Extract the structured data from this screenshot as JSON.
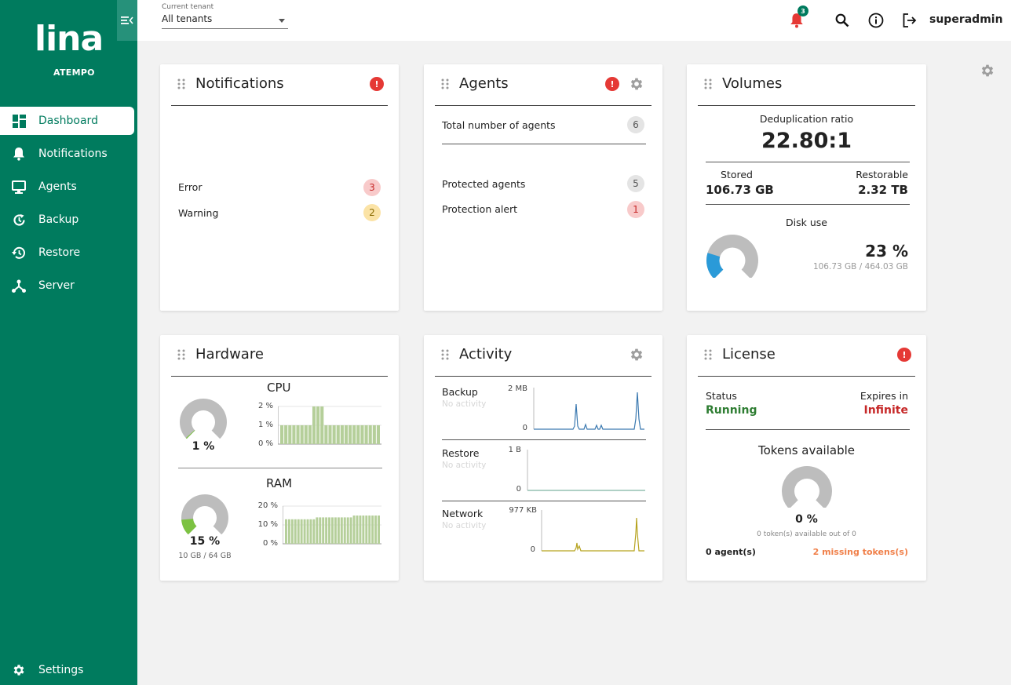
{
  "brand": {
    "logo": "lina",
    "logo_sub": "ATEMPO"
  },
  "sidebar": {
    "items": [
      {
        "label": "Dashboard",
        "icon": "dashboard-icon",
        "active": true
      },
      {
        "label": "Notifications",
        "icon": "bell-icon"
      },
      {
        "label": "Agents",
        "icon": "monitor-icon"
      },
      {
        "label": "Backup",
        "icon": "backup-icon"
      },
      {
        "label": "Restore",
        "icon": "restore-icon"
      },
      {
        "label": "Server",
        "icon": "server-icon"
      }
    ],
    "settings_label": "Settings"
  },
  "topbar": {
    "tenant_label": "Current tenant",
    "tenant_value": "All tenants",
    "notification_count": "3",
    "username": "superadmin"
  },
  "notifications": {
    "title": "Notifications",
    "alert": "!",
    "rows": [
      {
        "label": "Error",
        "count": "3"
      },
      {
        "label": "Warning",
        "count": "2"
      }
    ]
  },
  "agents": {
    "title": "Agents",
    "alert": "!",
    "total_label": "Total number of agents",
    "total": "6",
    "protected_label": "Protected agents",
    "protected": "5",
    "alert_label": "Protection alert",
    "alert_count": "1"
  },
  "volumes": {
    "title": "Volumes",
    "dedup_label": "Deduplication ratio",
    "dedup_value": "22.80:1",
    "stored_label": "Stored",
    "stored_value": "106.73 GB",
    "restorable_label": "Restorable",
    "restorable_value": "2.32 TB",
    "disk_label": "Disk use",
    "disk_percent": "23 %",
    "disk_fraction": 0.23,
    "disk_detail": "106.73 GB / 464.03 GB"
  },
  "hardware": {
    "title": "Hardware",
    "cpu_title": "CPU",
    "cpu_percent": "1 %",
    "cpu_fraction": 0.01,
    "cpu_axis": [
      "2 %",
      "1 %",
      "0 %"
    ],
    "cpu_bars": [
      1,
      1,
      1,
      1,
      1,
      1,
      1,
      1,
      2,
      2,
      2,
      1,
      1,
      1,
      1,
      1,
      1,
      1,
      1,
      1,
      1,
      1,
      1,
      1,
      1
    ],
    "ram_title": "RAM",
    "ram_percent": "15 %",
    "ram_fraction": 0.15,
    "ram_detail": "10 GB / 64 GB",
    "ram_axis": [
      "20 %",
      "10 %",
      "0 %"
    ],
    "ram_bars": [
      13,
      13,
      13,
      13,
      13,
      13,
      13,
      13,
      13,
      13,
      14,
      14,
      14,
      14,
      14,
      14,
      14,
      14,
      14,
      14,
      14,
      14,
      15,
      15,
      15,
      15,
      15,
      15,
      15,
      15,
      15
    ]
  },
  "activity": {
    "title": "Activity",
    "no_activity": "No activity",
    "backup": {
      "label": "Backup",
      "max": "2 MB",
      "min": "0"
    },
    "restore": {
      "label": "Restore",
      "max": "1 B",
      "min": "0"
    },
    "network": {
      "label": "Network",
      "max": "977 KB",
      "min": "0"
    }
  },
  "license": {
    "title": "License",
    "alert": "!",
    "status_label": "Status",
    "status_value": "Running",
    "expires_label": "Expires in",
    "expires_value": "Infinite",
    "tokens_title": "Tokens available",
    "tokens_percent": "0 %",
    "tokens_fraction": 0,
    "tokens_detail": "0 token(s) available out of 0",
    "agents_count": "0 agent(s)",
    "missing_tokens": "2 missing tokens(s)"
  },
  "colors": {
    "brand_green": "#007b5e",
    "alert_red": "#e53935",
    "running_green": "#2e7d32",
    "infinite_red": "#c62828",
    "missing_orange": "#f0804a",
    "gauge_grey": "#bdbdbd",
    "disk_blue": "#2a9ad8",
    "ram_green": "#7cc242",
    "bar_green": "#b5cf9a",
    "backup_line": "#3b79b0",
    "restore_line": "#7fb5a2",
    "network_line": "#b6a31f"
  }
}
